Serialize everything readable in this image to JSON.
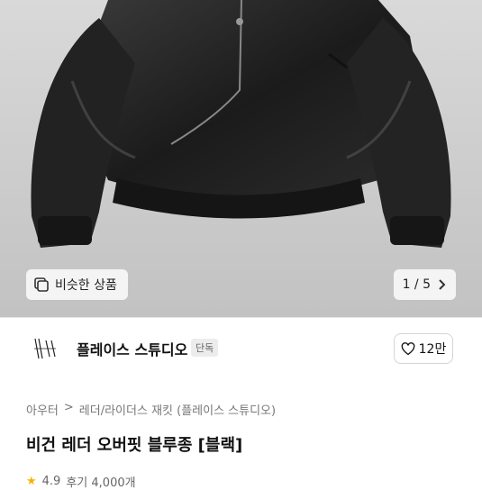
{
  "hero": {
    "similar_label": "비슷한 상품",
    "pager": "1 / 5",
    "image_icon": "gallery-icon",
    "next_icon": "chevron-right-icon"
  },
  "brand": {
    "name": "플레이스 스튜디오",
    "badge": "단독",
    "likes": "12만",
    "like_icon": "heart-icon"
  },
  "breadcrumb": [
    "아우터",
    "레더/라이더스 재킷 (플레이스 스튜디오)"
  ],
  "product": {
    "title": "비건 레더 오버핏 블루종 [블랙]",
    "rating": "4.9",
    "review_text": "후기 4,000개"
  }
}
